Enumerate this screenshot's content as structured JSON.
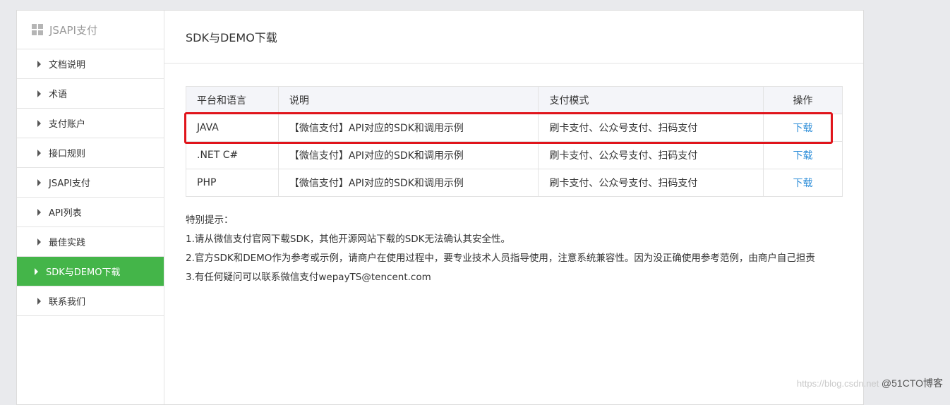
{
  "sidebar": {
    "header": "JSAPI支付",
    "items": [
      {
        "label": "文档说明"
      },
      {
        "label": "术语"
      },
      {
        "label": "支付账户"
      },
      {
        "label": "接口规则"
      },
      {
        "label": "JSAPI支付"
      },
      {
        "label": "API列表"
      },
      {
        "label": "最佳实践"
      },
      {
        "label": "SDK与DEMO下载"
      },
      {
        "label": "联系我们"
      }
    ],
    "active_index": 7
  },
  "main": {
    "title": "SDK与DEMO下载",
    "table": {
      "headers": [
        "平台和语言",
        "说明",
        "支付模式",
        "操作"
      ],
      "rows": [
        {
          "platform": "JAVA",
          "desc": "【微信支付】API对应的SDK和调用示例",
          "mode": "刷卡支付、公众号支付、扫码支付",
          "action": "下载"
        },
        {
          "platform": ".NET C#",
          "desc": "【微信支付】API对应的SDK和调用示例",
          "mode": "刷卡支付、公众号支付、扫码支付",
          "action": "下载"
        },
        {
          "platform": "PHP",
          "desc": "【微信支付】API对应的SDK和调用示例",
          "mode": "刷卡支付、公众号支付、扫码支付",
          "action": "下载"
        }
      ]
    },
    "notes": {
      "heading": "特别提示：",
      "lines": [
        "1.请从微信支付官网下载SDK，其他开源网站下载的SDK无法确认其安全性。",
        "2.官方SDK和DEMO作为参考或示例，请商户在使用过程中，要专业技术人员指导使用，注意系统兼容性。因为没正确使用参考范例，由商户自己担责",
        "3.有任何疑问可以联系微信支付wepayTS@tencent.com"
      ]
    }
  },
  "watermark": {
    "url": "https://blog.csdn.net",
    "brand": "@51CTO博客"
  },
  "colors": {
    "active": "#44b549",
    "link": "#2a8cd8",
    "highlight": "#e0141b"
  }
}
